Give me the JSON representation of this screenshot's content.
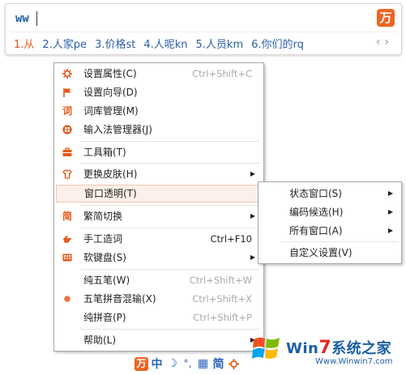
{
  "ime": {
    "composition": "ww",
    "logo_glyph": "万",
    "candidates": [
      "1.从",
      "2.人家pe",
      "3.价格st",
      "4.人呢kn",
      "5.人员km",
      "6.你们的rq"
    ],
    "nav_prev": "‹",
    "nav_next": "›"
  },
  "menu": {
    "items": [
      {
        "label": "设置属性(C)",
        "shortcut": "Ctrl+Shift+C",
        "icon": "gear-icon"
      },
      {
        "label": "设置向导(D)",
        "shortcut": "",
        "icon": "flag-icon"
      },
      {
        "label": "词库管理(M)",
        "shortcut": "",
        "icon": "dictionary-icon"
      },
      {
        "label": "输入法管理器(J)",
        "shortcut": "",
        "icon": "ime-manager-icon"
      },
      {
        "label": "工具箱(T)",
        "shortcut": "",
        "icon": "toolbox-icon"
      },
      {
        "label": "更换皮肤(H)",
        "shortcut": "",
        "icon": "shirt-icon"
      },
      {
        "label": "窗口透明(T)",
        "shortcut": "",
        "icon": ""
      },
      {
        "label": "繁简切换",
        "shortcut": "",
        "icon": "traditional-simplified-icon"
      },
      {
        "label": "手工造词",
        "shortcut": "Ctrl+F10",
        "icon": "hand-icon"
      },
      {
        "label": "软键盘(S)",
        "shortcut": "",
        "icon": "soft-keyboard-icon"
      },
      {
        "label": "纯五笔(W)",
        "shortcut": "Ctrl+Shift+W",
        "icon": ""
      },
      {
        "label": "五笔拼音混输(X)",
        "shortcut": "Ctrl+Shift+X",
        "icon": "selected-dot-icon"
      },
      {
        "label": "纯拼音(P)",
        "shortcut": "Ctrl+Shift+P",
        "icon": ""
      },
      {
        "label": "帮助(L)",
        "shortcut": "",
        "icon": ""
      }
    ]
  },
  "submenu": {
    "items": [
      {
        "label": "状态窗口(S)"
      },
      {
        "label": "编码候选(H)"
      },
      {
        "label": "所有窗口(A)"
      },
      {
        "label": "自定义设置(V)"
      }
    ]
  },
  "statusbar": {
    "logo": "万",
    "lang": "中",
    "moon": "☽",
    "punct": "°,",
    "keyboard": "▦",
    "jian": "简"
  },
  "watermark": {
    "text_a": "Win",
    "text_7": "7",
    "text_b": "系统之家",
    "url": "Www.Winwin7.com"
  },
  "colors": {
    "accent": "#f06422",
    "candidate": "#2a5ea8",
    "highlight_bg": "#fdf0ea"
  }
}
